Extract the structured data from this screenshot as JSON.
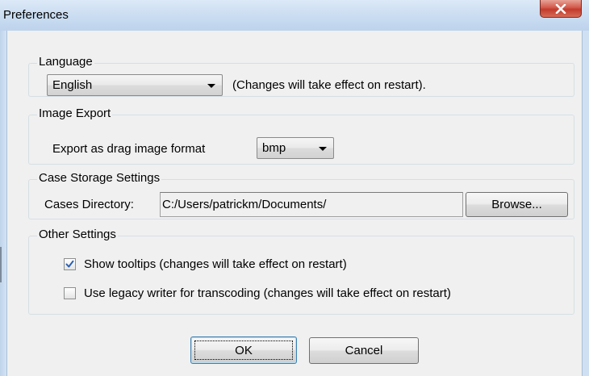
{
  "window": {
    "title": "Preferences"
  },
  "language": {
    "group_title": "Language",
    "selected": "English",
    "note": "(Changes will take effect on restart)."
  },
  "image_export": {
    "group_title": "Image Export",
    "label": "Export as drag image format",
    "selected": "bmp"
  },
  "case_storage": {
    "group_title": "Case Storage Settings",
    "label": "Cases Directory:",
    "directory": "C:/Users/patrickm/Documents/",
    "browse_label": "Browse..."
  },
  "other_settings": {
    "group_title": "Other Settings",
    "options": [
      {
        "label": "Show tooltips (changes will take effect on restart)",
        "checked": true
      },
      {
        "label": "Use legacy writer for transcoding (changes will take effect on restart)",
        "checked": false
      }
    ]
  },
  "buttons": {
    "ok_label": "OK",
    "cancel_label": "Cancel"
  },
  "icons": {
    "close": "close-icon",
    "checkmark": "checkmark-icon",
    "dropdown": "chevron-down-icon"
  }
}
